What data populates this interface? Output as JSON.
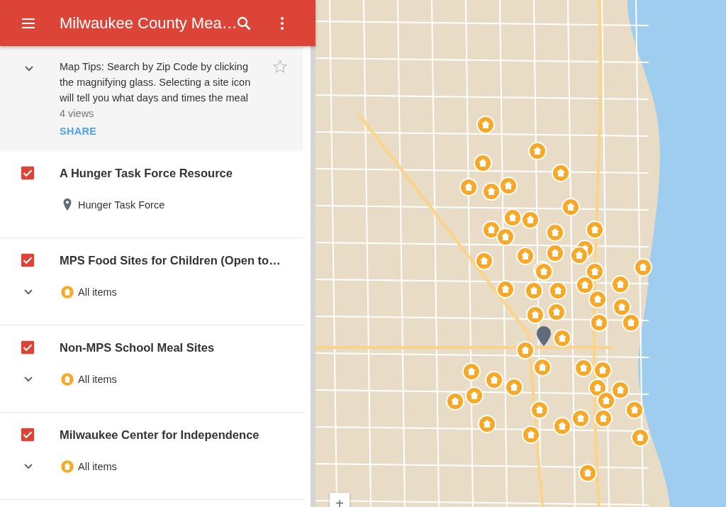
{
  "app_bar": {
    "title": "Milwaukee County Mea…"
  },
  "description": {
    "text": "Map Tips: Search by Zip Code by clicking the magnifying glass. Selecting a site icon will tell you what days and times the meal",
    "views": "4 views",
    "share": "SHARE",
    "starred": false
  },
  "layers": [
    {
      "title": "A Hunger Task Force Resource",
      "checked": true,
      "item": {
        "kind": "pin",
        "label": "Hunger Task Force"
      }
    },
    {
      "title": "MPS Food Sites for Children (Open to…",
      "checked": true,
      "item": {
        "kind": "group",
        "label": "All items"
      }
    },
    {
      "title": "Non-MPS School Meal Sites",
      "checked": true,
      "item": {
        "kind": "group",
        "label": "All items"
      }
    },
    {
      "title": "Milwaukee Center for Independence",
      "checked": true,
      "item": {
        "kind": "group",
        "label": "All items"
      }
    }
  ],
  "map": {
    "zoom_in": "+"
  }
}
